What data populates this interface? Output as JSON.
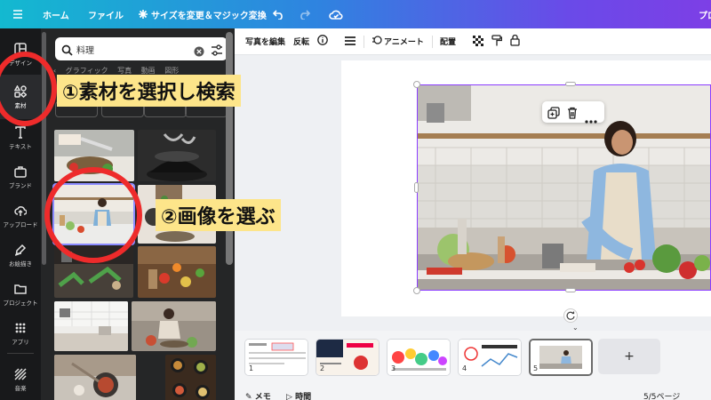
{
  "topbar": {
    "home": "ホーム",
    "file": "ファイル",
    "resize": "サイズを変更＆マジック変換",
    "right_text": "プロ"
  },
  "rail": [
    {
      "label": "デザイン",
      "icon": "layout-icon"
    },
    {
      "label": "素材",
      "icon": "shapes-icon"
    },
    {
      "label": "テキスト",
      "icon": "text-icon"
    },
    {
      "label": "ブランド",
      "icon": "brand-icon"
    },
    {
      "label": "アップロード",
      "icon": "upload-icon"
    },
    {
      "label": "お絵描き",
      "icon": "draw-icon"
    },
    {
      "label": "プロジェクト",
      "icon": "folder-icon"
    },
    {
      "label": "アプリ",
      "icon": "apps-icon"
    },
    {
      "label": "音楽",
      "icon": "music-icon"
    }
  ],
  "panel": {
    "search_value": "料理",
    "tabs": [
      "グラフィック",
      "写真",
      "動画",
      "図形"
    ]
  },
  "toolbar": {
    "edit_photo": "写真を編集",
    "flip": "反転",
    "animate": "アニメート",
    "position": "配置"
  },
  "annotations": {
    "step1": "①素材を選択し検索",
    "step2": "②画像を選ぶ"
  },
  "pages": [
    "1",
    "2",
    "3",
    "4",
    "5"
  ],
  "bottombar": {
    "notes": "メモ",
    "timer": "時間",
    "page_count": "5/5ページ"
  },
  "colors": {
    "accent": "#8b3dff",
    "annotation_circle": "#ee2b2b",
    "callout_bg": "#fde58a"
  }
}
